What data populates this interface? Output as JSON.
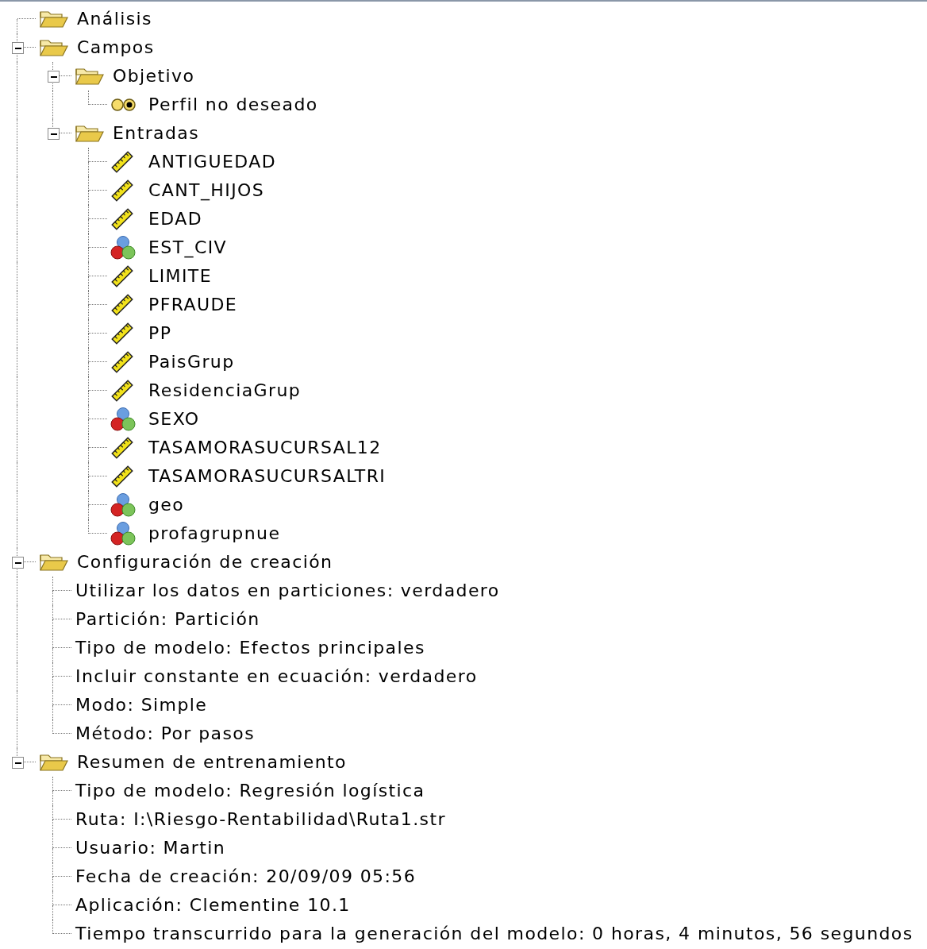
{
  "tree": [
    {
      "label": "Análisis",
      "kind": "folder"
    },
    {
      "label": "Campos",
      "kind": "folder",
      "expanded": true,
      "children": [
        {
          "label": "Objetivo",
          "kind": "folder",
          "expanded": true,
          "children": [
            {
              "label": "Perfil no deseado",
              "kind": "flag"
            }
          ]
        },
        {
          "label": "Entradas",
          "kind": "folder",
          "expanded": true,
          "children": [
            {
              "label": "ANTIGUEDAD",
              "kind": "range"
            },
            {
              "label": "CANT_HIJOS",
              "kind": "range"
            },
            {
              "label": "EDAD",
              "kind": "range"
            },
            {
              "label": "EST_CIV",
              "kind": "set"
            },
            {
              "label": "LIMITE",
              "kind": "range"
            },
            {
              "label": "PFRAUDE",
              "kind": "range"
            },
            {
              "label": "PP",
              "kind": "range"
            },
            {
              "label": "PaisGrup",
              "kind": "range"
            },
            {
              "label": "ResidenciaGrup",
              "kind": "range"
            },
            {
              "label": "SEXO",
              "kind": "set"
            },
            {
              "label": "TASAMORASUCURSAL12",
              "kind": "range"
            },
            {
              "label": "TASAMORASUCURSALTRI",
              "kind": "range"
            },
            {
              "label": "geo",
              "kind": "set"
            },
            {
              "label": "profagrupnue",
              "kind": "set"
            }
          ]
        }
      ]
    },
    {
      "label": "Configuración de creación",
      "kind": "folder",
      "expanded": true,
      "children": [
        {
          "label": "Utilizar los datos en particiones: verdadero",
          "kind": "text"
        },
        {
          "label": "Partición: Partición",
          "kind": "text"
        },
        {
          "label": "Tipo de modelo: Efectos principales",
          "kind": "text"
        },
        {
          "label": "Incluir constante en ecuación: verdadero",
          "kind": "text"
        },
        {
          "label": "Modo: Simple",
          "kind": "text"
        },
        {
          "label": "Método: Por pasos",
          "kind": "text"
        }
      ]
    },
    {
      "label": "Resumen de entrenamiento",
      "kind": "folder",
      "expanded": true,
      "children": [
        {
          "label": "Tipo de modelo: Regresión logística",
          "kind": "text"
        },
        {
          "label": "Ruta: I:\\Riesgo-Rentabilidad\\Ruta1.str",
          "kind": "text"
        },
        {
          "label": "Usuario: Martin",
          "kind": "text"
        },
        {
          "label": "Fecha de creación: 20/09/09 05:56",
          "kind": "text"
        },
        {
          "label": "Aplicación: Clementine 10.1",
          "kind": "text"
        },
        {
          "label": "Tiempo transcurrido para la generación del modelo: 0 horas, 4 minutos, 56 segundos",
          "kind": "text"
        }
      ]
    }
  ]
}
